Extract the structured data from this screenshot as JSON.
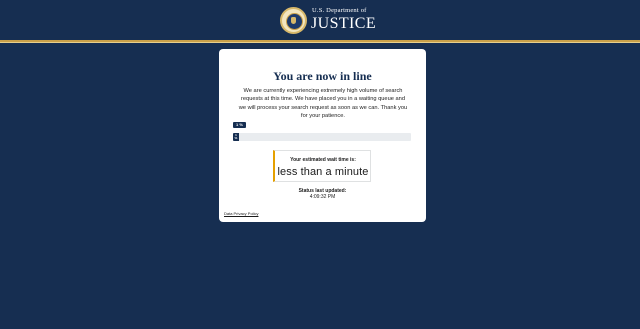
{
  "header": {
    "agency_top": "U.S. Department of",
    "agency_main": "JUSTICE",
    "seal_icon": "doj-seal-icon"
  },
  "queue": {
    "title": "You are now in line",
    "message": "We are currently experiencing extremely high volume of search requests at this time. We have placed you in a waiting queue and we will process your search request as soon as we can. Thank you for your patience.",
    "progress_tag": "1 %",
    "progress_percent": 1,
    "progress_bar_label": "1 %",
    "wait_label": "Your estimated wait time is:",
    "wait_value": "less than a minute",
    "status_label": "Status last updated:",
    "status_time": "4:09:32 PM",
    "privacy_link": "Data Privacy Policy"
  },
  "colors": {
    "background": "#162e51",
    "accent_gold": "#c9a04a",
    "wait_border": "#e5a000"
  }
}
